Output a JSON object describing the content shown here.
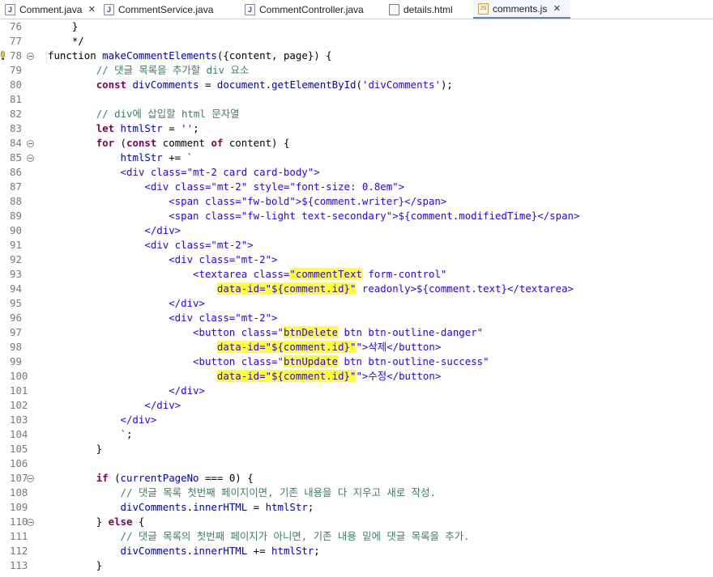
{
  "tabs": [
    {
      "label": "Comment.java",
      "icon": "java-file-icon",
      "active": false,
      "closable": true
    },
    {
      "label": "CommentService.java",
      "icon": "java-file-icon",
      "active": false,
      "closable": false
    },
    {
      "label": "CommentController.java",
      "icon": "java-file-icon",
      "active": false,
      "closable": false
    },
    {
      "label": "details.html",
      "icon": "html-file-icon",
      "active": false,
      "closable": false
    },
    {
      "label": "comments.js",
      "icon": "js-file-icon",
      "active": true,
      "closable": true
    }
  ],
  "colors": {
    "keyword": "#7f0055",
    "comment": "#3f7f5f",
    "string": "#2a00ff",
    "variable": "#0000c0",
    "highlight": "#ffff33",
    "line_number": "#787878"
  },
  "lines": [
    {
      "n": "76",
      "fold": false,
      "marker": false,
      "tokens": [
        [
          "p",
          "    }"
        ]
      ]
    },
    {
      "n": "77",
      "fold": false,
      "marker": false,
      "tokens": [
        [
          "p",
          "    */"
        ]
      ]
    },
    {
      "n": "78",
      "fold": true,
      "marker": true,
      "tokens": [
        [
          "p",
          "function "
        ],
        [
          "v",
          "makeCommentElements"
        ],
        [
          "p",
          "({content, page}) {"
        ]
      ]
    },
    {
      "n": "79",
      "fold": false,
      "marker": false,
      "tokens": [
        [
          "p",
          "        "
        ],
        [
          "c",
          "// 댓글 목록을 추가할 div 요소"
        ]
      ]
    },
    {
      "n": "80",
      "fold": false,
      "marker": false,
      "tokens": [
        [
          "p",
          "        "
        ],
        [
          "k",
          "const"
        ],
        [
          "p",
          " "
        ],
        [
          "v",
          "divComments"
        ],
        [
          "p",
          " = "
        ],
        [
          "v",
          "document"
        ],
        [
          "p",
          "."
        ],
        [
          "v",
          "getElementById"
        ],
        [
          "p",
          "("
        ],
        [
          "s",
          "'divComments'"
        ],
        [
          "p",
          ");"
        ]
      ]
    },
    {
      "n": "81",
      "fold": false,
      "marker": false,
      "tokens": []
    },
    {
      "n": "82",
      "fold": false,
      "marker": false,
      "tokens": [
        [
          "p",
          "        "
        ],
        [
          "c",
          "// div에 삽입할 html 문자열"
        ]
      ]
    },
    {
      "n": "83",
      "fold": false,
      "marker": false,
      "tokens": [
        [
          "p",
          "        "
        ],
        [
          "k",
          "let"
        ],
        [
          "p",
          " "
        ],
        [
          "v",
          "htmlStr"
        ],
        [
          "p",
          " = "
        ],
        [
          "s",
          "''"
        ],
        [
          "p",
          ";"
        ]
      ]
    },
    {
      "n": "84",
      "fold": true,
      "marker": false,
      "tokens": [
        [
          "p",
          "        "
        ],
        [
          "k",
          "for"
        ],
        [
          "p",
          " ("
        ],
        [
          "k",
          "const"
        ],
        [
          "p",
          " comment "
        ],
        [
          "k",
          "of"
        ],
        [
          "p",
          " content) {"
        ]
      ]
    },
    {
      "n": "85",
      "fold": true,
      "marker": false,
      "tokens": [
        [
          "p",
          "            "
        ],
        [
          "v",
          "htmlStr"
        ],
        [
          "p",
          " += "
        ],
        [
          "s",
          "`"
        ]
      ]
    },
    {
      "n": "86",
      "fold": false,
      "marker": false,
      "tokens": [
        [
          "s",
          "            <div class=\"mt-2 card card-body\">"
        ]
      ]
    },
    {
      "n": "87",
      "fold": false,
      "marker": false,
      "tokens": [
        [
          "s",
          "                <div class=\"mt-2\" style=\"font-size: 0.8em\">"
        ]
      ]
    },
    {
      "n": "88",
      "fold": false,
      "marker": false,
      "tokens": [
        [
          "s",
          "                    <span class=\"fw-bold\">${comment.writer}</span>"
        ]
      ]
    },
    {
      "n": "89",
      "fold": false,
      "marker": false,
      "tokens": [
        [
          "s",
          "                    <span class=\"fw-light text-secondary\">${comment.modifiedTime}</span>"
        ]
      ]
    },
    {
      "n": "90",
      "fold": false,
      "marker": false,
      "tokens": [
        [
          "s",
          "                </div>"
        ]
      ]
    },
    {
      "n": "91",
      "fold": false,
      "marker": false,
      "tokens": [
        [
          "s",
          "                <div class=\"mt-2\">"
        ]
      ]
    },
    {
      "n": "92",
      "fold": false,
      "marker": false,
      "tokens": [
        [
          "s",
          "                    <div class=\"mt-2\">"
        ]
      ]
    },
    {
      "n": "93",
      "fold": false,
      "marker": false,
      "tokens": [
        [
          "s",
          "                        <textarea class="
        ],
        [
          "h",
          "\"commentText"
        ],
        [
          "s",
          " form-control\""
        ]
      ]
    },
    {
      "n": "94",
      "fold": false,
      "marker": false,
      "tokens": [
        [
          "s",
          "                            "
        ],
        [
          "h",
          "data-id=\"${comment.id}\""
        ],
        [
          "s",
          " readonly>${comment.text}</textarea>"
        ]
      ]
    },
    {
      "n": "95",
      "fold": false,
      "marker": false,
      "tokens": [
        [
          "s",
          "                    </div>"
        ]
      ]
    },
    {
      "n": "96",
      "fold": false,
      "marker": false,
      "tokens": [
        [
          "s",
          "                    <div class=\"mt-2\">"
        ]
      ]
    },
    {
      "n": "97",
      "fold": false,
      "marker": false,
      "tokens": [
        [
          "s",
          "                        <button class=\""
        ],
        [
          "h",
          "btnDelete"
        ],
        [
          "s",
          " btn btn-outline-danger\""
        ]
      ]
    },
    {
      "n": "98",
      "fold": false,
      "marker": false,
      "tokens": [
        [
          "s",
          "                            "
        ],
        [
          "h",
          "data-id=\"${comment.id}\""
        ],
        [
          "s",
          "\">삭제</button>"
        ]
      ]
    },
    {
      "n": "99",
      "fold": false,
      "marker": false,
      "tokens": [
        [
          "s",
          "                        <button class=\""
        ],
        [
          "h",
          "btnUpdate"
        ],
        [
          "s",
          " btn btn-outline-success\""
        ]
      ]
    },
    {
      "n": "100",
      "fold": false,
      "marker": false,
      "tokens": [
        [
          "s",
          "                            "
        ],
        [
          "h",
          "data-id=\"${comment.id}\""
        ],
        [
          "s",
          "\">수정</button>"
        ]
      ]
    },
    {
      "n": "101",
      "fold": false,
      "marker": false,
      "tokens": [
        [
          "s",
          "                    </div>"
        ]
      ]
    },
    {
      "n": "102",
      "fold": false,
      "marker": false,
      "tokens": [
        [
          "s",
          "                </div>"
        ]
      ]
    },
    {
      "n": "103",
      "fold": false,
      "marker": false,
      "tokens": [
        [
          "s",
          "            </div>"
        ]
      ]
    },
    {
      "n": "104",
      "fold": false,
      "marker": false,
      "tokens": [
        [
          "s",
          "            `"
        ],
        [
          "p",
          ";"
        ]
      ]
    },
    {
      "n": "105",
      "fold": false,
      "marker": false,
      "tokens": [
        [
          "p",
          "        }"
        ]
      ]
    },
    {
      "n": "106",
      "fold": false,
      "marker": false,
      "tokens": []
    },
    {
      "n": "107",
      "fold": true,
      "marker": false,
      "tokens": [
        [
          "p",
          "        "
        ],
        [
          "k",
          "if"
        ],
        [
          "p",
          " ("
        ],
        [
          "v",
          "currentPageNo"
        ],
        [
          "p",
          " === 0) {"
        ]
      ]
    },
    {
      "n": "108",
      "fold": false,
      "marker": false,
      "tokens": [
        [
          "p",
          "            "
        ],
        [
          "c",
          "// 댓글 목록 첫번째 페이지이면, 기존 내용을 다 지우고 새로 작성."
        ]
      ]
    },
    {
      "n": "109",
      "fold": false,
      "marker": false,
      "tokens": [
        [
          "p",
          "            "
        ],
        [
          "v",
          "divComments"
        ],
        [
          "p",
          "."
        ],
        [
          "v",
          "innerHTML"
        ],
        [
          "p",
          " = "
        ],
        [
          "v",
          "htmlStr"
        ],
        [
          "p",
          ";"
        ]
      ]
    },
    {
      "n": "110",
      "fold": true,
      "marker": false,
      "tokens": [
        [
          "p",
          "        } "
        ],
        [
          "k",
          "else"
        ],
        [
          "p",
          " {"
        ]
      ]
    },
    {
      "n": "111",
      "fold": false,
      "marker": false,
      "tokens": [
        [
          "p",
          "            "
        ],
        [
          "c",
          "// 댓글 목록의 첫번째 페이지가 아니면, 기존 내용 밑에 댓글 목록을 추가."
        ]
      ]
    },
    {
      "n": "112",
      "fold": false,
      "marker": false,
      "tokens": [
        [
          "p",
          "            "
        ],
        [
          "v",
          "divComments"
        ],
        [
          "p",
          "."
        ],
        [
          "v",
          "innerHTML"
        ],
        [
          "p",
          " += "
        ],
        [
          "v",
          "htmlStr"
        ],
        [
          "p",
          ";"
        ]
      ]
    },
    {
      "n": "113",
      "fold": false,
      "marker": false,
      "tokens": [
        [
          "p",
          "        }"
        ]
      ]
    }
  ]
}
